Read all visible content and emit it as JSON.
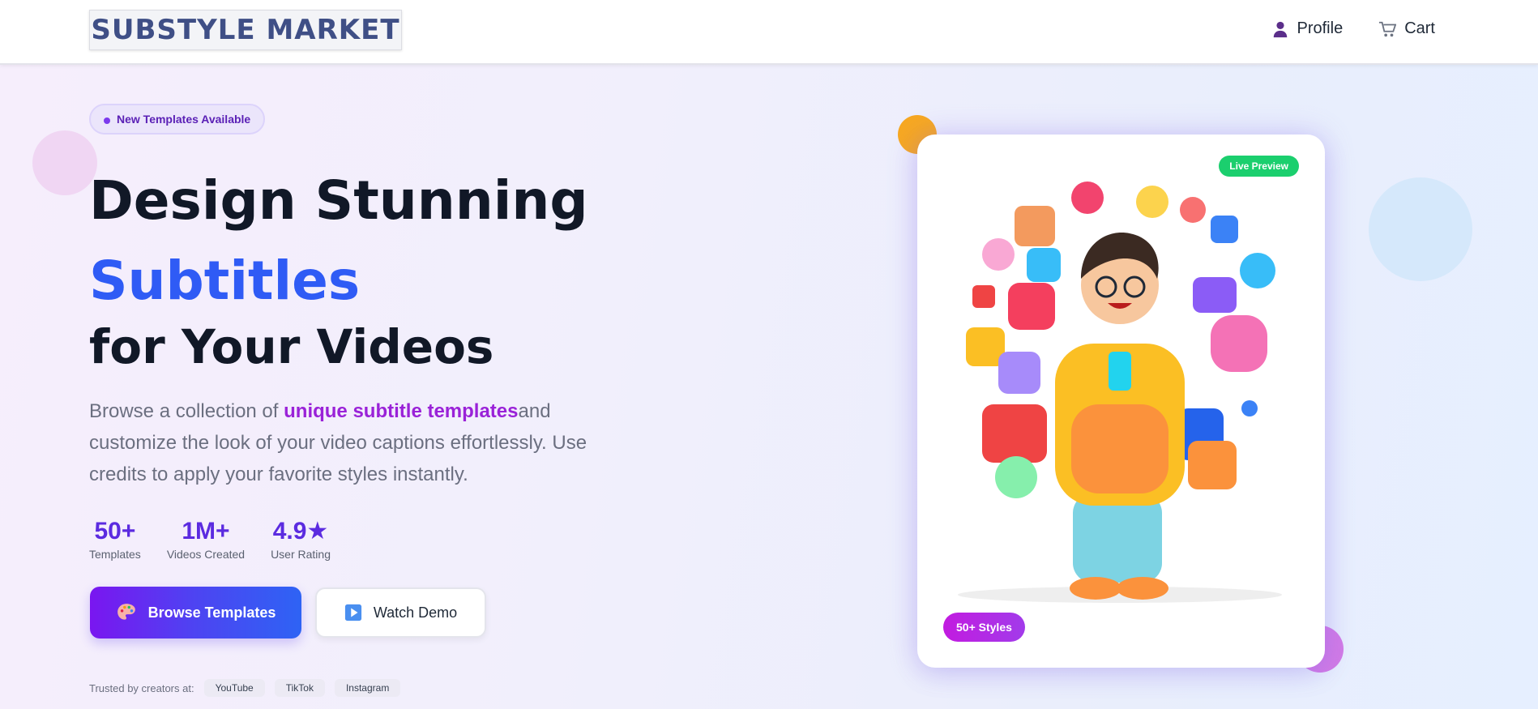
{
  "header": {
    "logo_text": "SUBSTYLE MARKET",
    "nav": [
      {
        "label": "Profile",
        "icon": "user-icon"
      },
      {
        "label": "Cart",
        "icon": "cart-icon"
      }
    ]
  },
  "hero": {
    "badge": "New Templates Available",
    "headline_line1": "Design Stunning",
    "headline_line2": "Subtitles",
    "headline_line3": "for Your Videos",
    "description_before": "Browse a collection of ",
    "description_highlight": "unique subtitle templates",
    "description_after": "and customize the look of your video captions effortlessly. Use credits to apply your favorite styles instantly.",
    "stats": [
      {
        "value": "50+",
        "label": "Templates"
      },
      {
        "value": "1M+",
        "label": "Videos Created"
      },
      {
        "value": "4.9★",
        "label": "User Rating"
      }
    ],
    "primary_button": {
      "label": "Browse Templates",
      "icon": "palette-icon"
    },
    "secondary_button": {
      "label": "Watch Demo",
      "icon": "play-icon"
    },
    "trusted_label": "Trusted by creators at:",
    "platforms": [
      "YouTube",
      "TikTok",
      "Instagram"
    ]
  },
  "preview": {
    "live_badge": "Live Preview",
    "styles_badge": "50+ Styles",
    "image_icon": "character-with-social-icons-illustration"
  },
  "colors": {
    "brand": "#3f4f86",
    "accent_blue": "#2f5bf5",
    "accent_purple": "#9a22d8",
    "stat_purple": "#5b2be0",
    "live_green": "#1bcf6e"
  }
}
